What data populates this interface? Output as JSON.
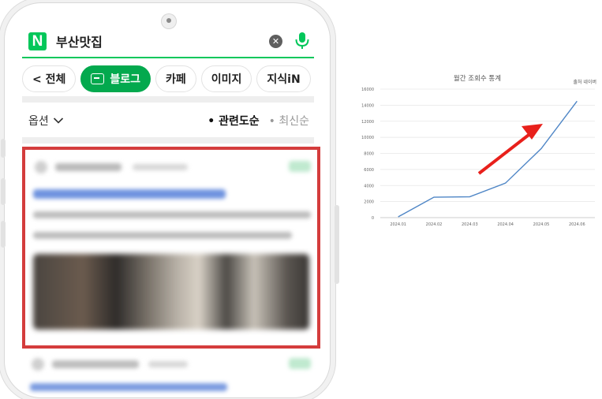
{
  "search": {
    "query": "부산맛집",
    "logo": "N"
  },
  "tabs": [
    {
      "label": "< 전체"
    },
    {
      "label": "블로그",
      "active": true
    },
    {
      "label": "카페"
    },
    {
      "label": "이미지"
    },
    {
      "label": "지식iN"
    }
  ],
  "options": {
    "label": "옵션",
    "sort_active": "• 관련도순",
    "sort_other": "• 최신순"
  },
  "colors": {
    "naver_green": "#03c75a",
    "highlight": "#d43c3c",
    "arrow": "#e8201b",
    "line": "#4f86c6"
  },
  "chart_data": {
    "type": "line",
    "title": "월간 조회수 통계",
    "source": "출처 네이버",
    "categories": [
      "2024.01",
      "2024.02",
      "2024.03",
      "2024.04",
      "2024.05",
      "2024.06"
    ],
    "values": [
      100,
      2550,
      2600,
      4300,
      8600,
      14500
    ],
    "yticks": [
      0,
      2000,
      4000,
      6000,
      8000,
      10000,
      12000,
      14000,
      16000
    ],
    "ylim": [
      0,
      16000
    ],
    "grid": true
  }
}
